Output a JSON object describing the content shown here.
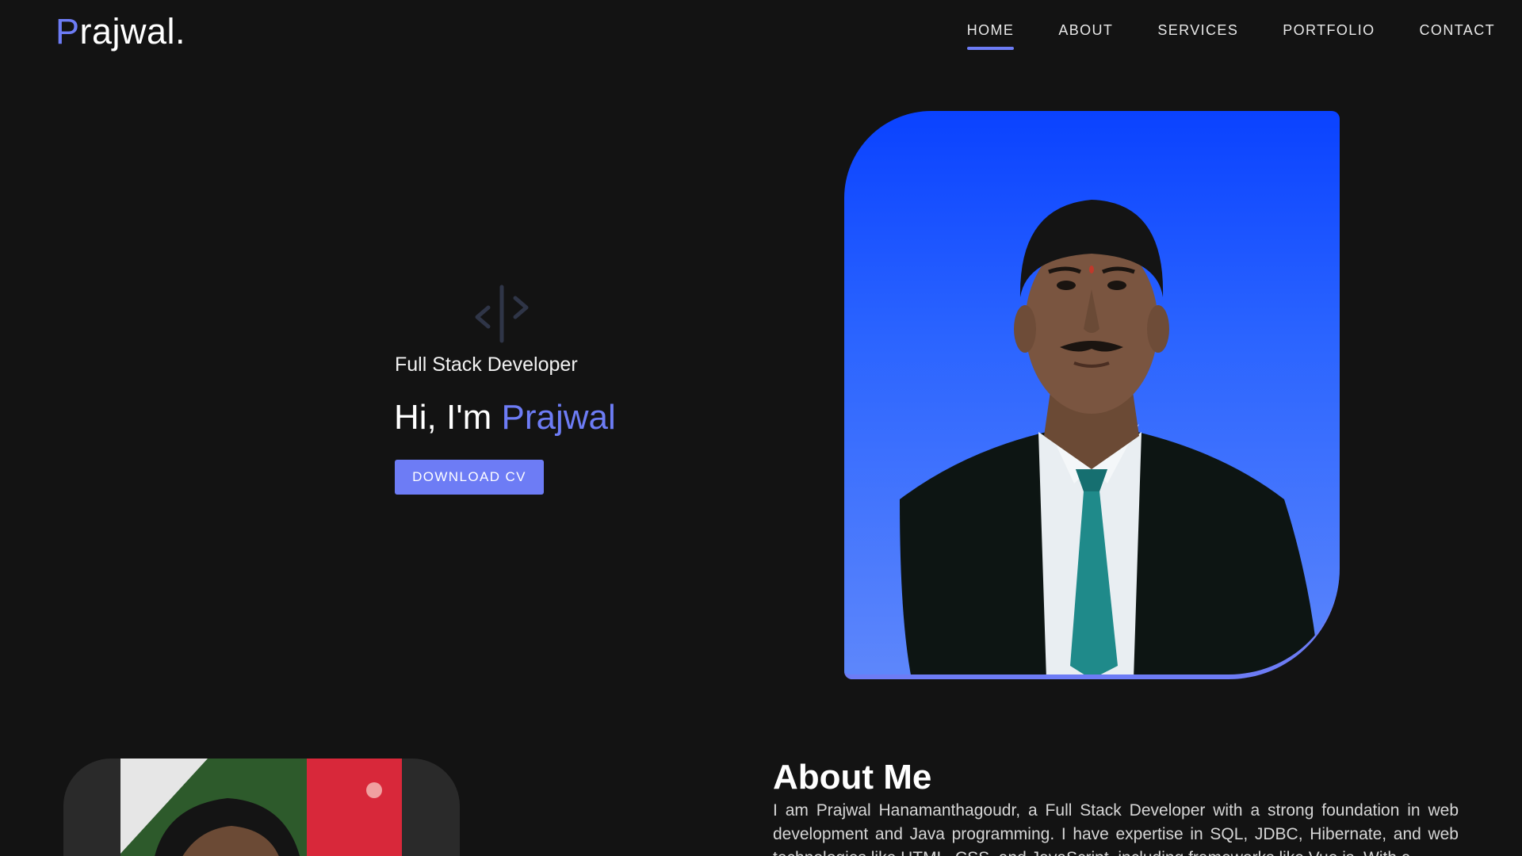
{
  "brand": {
    "initial": "P",
    "rest": "rajwal."
  },
  "nav": {
    "items": [
      {
        "label": "HOME",
        "active": true
      },
      {
        "label": "ABOUT"
      },
      {
        "label": "SERVICES"
      },
      {
        "label": "PORTFOLIO"
      },
      {
        "label": "CONTACT"
      }
    ]
  },
  "hero": {
    "icon": "code-icon",
    "subtitle": "Full Stack Developer",
    "greeting": "Hi, I'm ",
    "name": "Prajwal",
    "cv_button": "DOWNLOAD CV"
  },
  "about": {
    "heading": "About Me",
    "text": "I am Prajwal Hanamanthagoudr, a Full Stack Developer with a strong foundation in web development and Java programming. I have expertise in SQL, JDBC, Hibernate, and web technologies like HTML, CSS, and JavaScript, including frameworks like Vue.js. With a"
  },
  "colors": {
    "background": "#131313",
    "accent": "#6d7cf5",
    "portrait_gradient_top": "#0a42ff",
    "portrait_gradient_bottom": "#5e87fb"
  }
}
